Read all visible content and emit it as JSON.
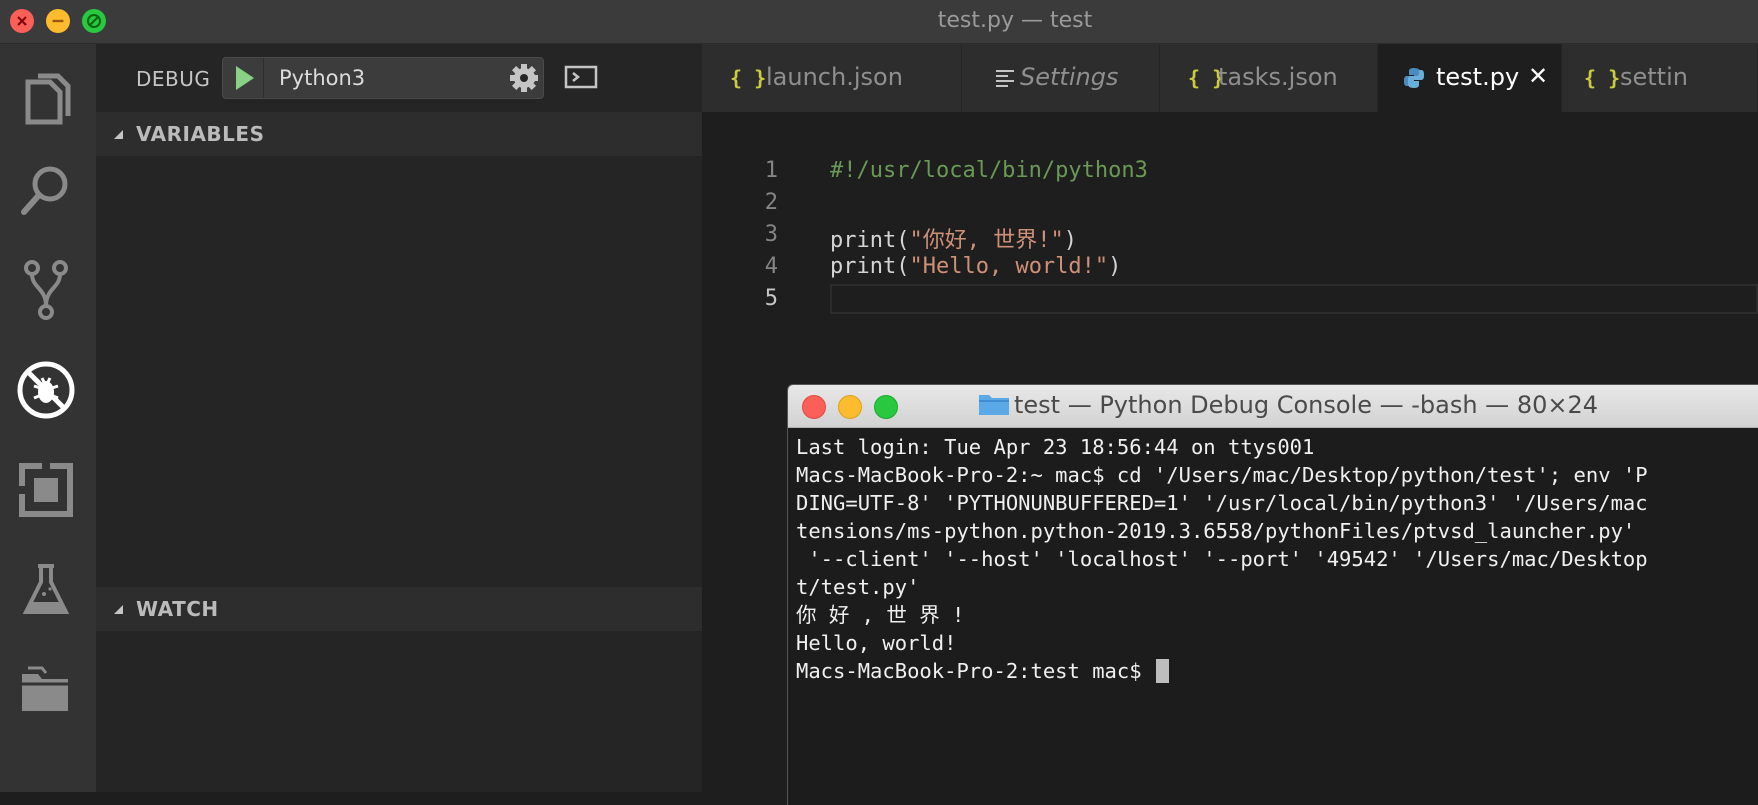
{
  "window": {
    "title": "test.py — test"
  },
  "activity_bar": {
    "icons": [
      "explorer-icon",
      "search-icon",
      "source-control-icon",
      "debug-icon",
      "extensions-icon",
      "test-flask-icon",
      "folders-icon"
    ],
    "active": "debug-icon"
  },
  "debug": {
    "label": "DEBUG",
    "configuration": "Python3",
    "sections": {
      "variables": "VARIABLES",
      "watch": "WATCH"
    }
  },
  "tabs": [
    {
      "label": "launch.json",
      "icon": "{ }",
      "active": false
    },
    {
      "label": "Settings",
      "icon": "settings-lines-icon",
      "active": false
    },
    {
      "label": "tasks.json",
      "icon": "{ }",
      "active": false
    },
    {
      "label": "test.py",
      "icon": "python-icon",
      "active": true,
      "close": "✕"
    },
    {
      "label": "settin",
      "icon": "{ }",
      "active": false
    }
  ],
  "editor": {
    "line_numbers": [
      "1",
      "2",
      "3",
      "4",
      "5"
    ],
    "lines": {
      "l1_comment": "#!/usr/local/bin/python3",
      "l3_fn": "print(",
      "l3_str": "\"你好, 世界!\"",
      "l3_close": ")",
      "l4_fn": "print(",
      "l4_str": "\"Hello, world!\"",
      "l4_close": ")"
    }
  },
  "terminal": {
    "title": "test — Python Debug Console — -bash — 80×24",
    "lines": [
      "Last login: Tue Apr 23 18:56:44 on ttys001",
      "Macs-MacBook-Pro-2:~ mac$ cd '/Users/mac/Desktop/python/test'; env 'P",
      "DING=UTF-8' 'PYTHONUNBUFFERED=1' '/usr/local/bin/python3' '/Users/mac",
      "tensions/ms-python.python-2019.3.6558/pythonFiles/ptvsd_launcher.py'",
      " '--client' '--host' 'localhost' '--port' '49542' '/Users/mac/Desktop",
      "t/test.py'",
      "你 好 , 世 界 !",
      "Hello, world!"
    ],
    "prompt": "Macs-MacBook-Pro-2:test mac$ "
  },
  "colors": {
    "accent_green": "#89d185",
    "json_icon": "#cbcb41",
    "python_icon": "#4b8bbe",
    "comment": "#6a9955",
    "string": "#ce9178"
  }
}
